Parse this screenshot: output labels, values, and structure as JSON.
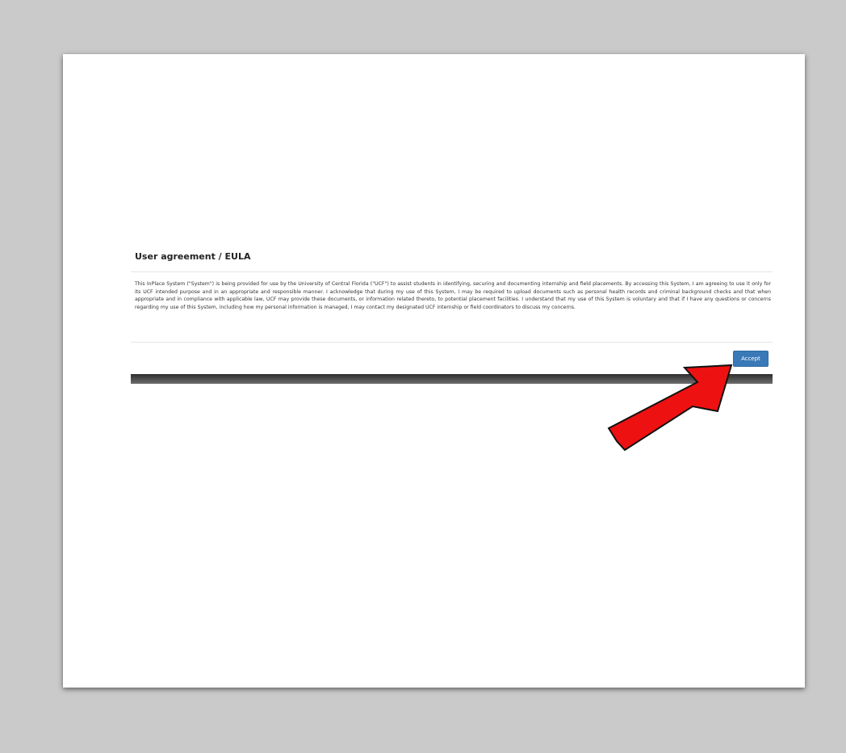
{
  "dialog": {
    "title": "User agreement / EULA",
    "body": "This InPlace System (\"System\") is being provided for use by the University of Central Florida (\"UCF\") to assist students in identifying, securing and documenting internship and field placements. By accessing this System, I am agreeing to use it only for its UCF intended purpose and in an appropriate and responsible manner.  I acknowledge that during my use of this System, I may be required to upload documents such as personal health records and criminal background checks and that when appropriate and in compliance with applicable law, UCF may provide these documents, or information related thereto, to potential placement facilities.  I understand that my use of this System is voluntary and that if I have any questions or concerns regarding my use of this System, including how my personal information is managed, I may contact my designated UCF internship or field coordinators to discuss my concerns.",
    "accept_label": "Accept"
  },
  "annotation": {
    "icon": "red-arrow-icon",
    "fill_color": "#ee1111",
    "stroke_color": "#111111"
  },
  "colors": {
    "background": "#c9cac9",
    "slide": "#ffffff",
    "button": "#3a79b8"
  }
}
